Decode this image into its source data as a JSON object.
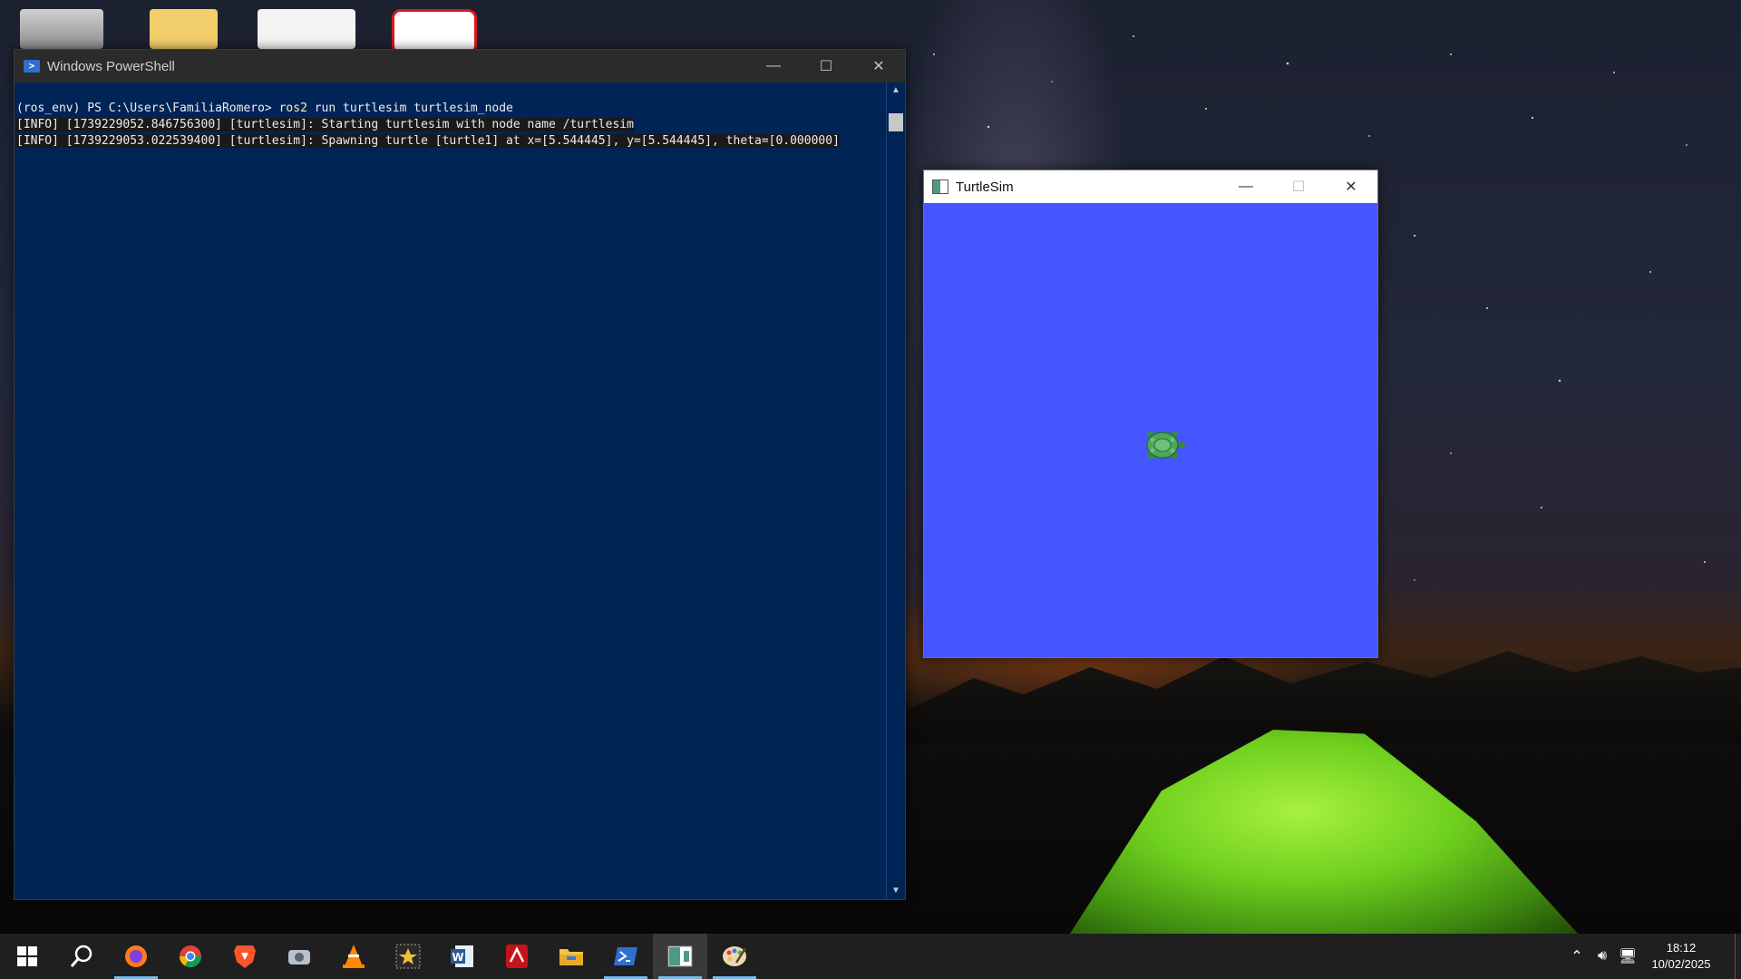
{
  "powershell": {
    "title": "Windows PowerShell",
    "lines": {
      "l1_prefix": "(ros_env) PS C:\\Users\\FamiliaRomero> ",
      "l1_cmd": "ros2",
      "l1_args": " run turtlesim turtlesim_node",
      "l2": "[INFO] [1739229052.846756300] [turtlesim]: Starting turtlesim with node name /turtlesim",
      "l3": "[INFO] [1739229053.022539400] [turtlesim]: Spawning turtle [turtle1] at x=[5.544445], y=[5.544445], theta=[0.000000]"
    }
  },
  "turtlesim": {
    "title": "TurtleSim",
    "background_color": "#4556ff"
  },
  "taskbar": {
    "items": [
      {
        "icon": "windows-start-icon",
        "running": false
      },
      {
        "icon": "search-icon",
        "running": false
      },
      {
        "icon": "firefox-icon",
        "running": true
      },
      {
        "icon": "chrome-icon",
        "running": false
      },
      {
        "icon": "brave-icon",
        "running": false
      },
      {
        "icon": "scanner-app-icon",
        "running": false
      },
      {
        "icon": "vlc-icon",
        "running": false
      },
      {
        "icon": "movie-maker-icon",
        "running": false
      },
      {
        "icon": "word-icon",
        "running": false
      },
      {
        "icon": "acrobat-icon",
        "running": false
      },
      {
        "icon": "file-explorer-icon",
        "running": false
      },
      {
        "icon": "powershell-icon",
        "running": true
      },
      {
        "icon": "turtlesim-icon",
        "running": true
      },
      {
        "icon": "paint-icon",
        "running": true
      }
    ],
    "clock": {
      "time": "18:12",
      "date": "10/02/2025"
    }
  }
}
